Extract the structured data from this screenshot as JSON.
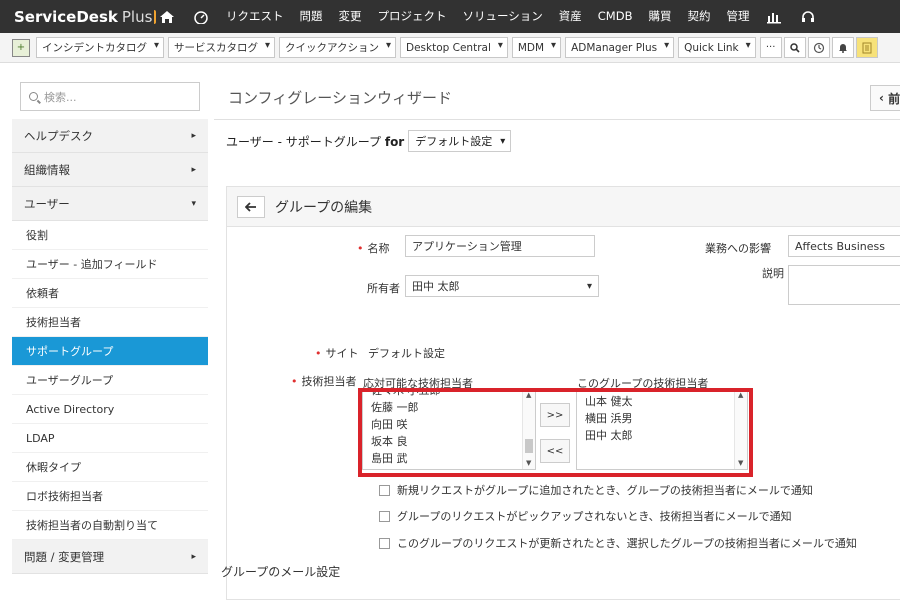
{
  "brand": {
    "name": "ServiceDesk",
    "plus": "Plus"
  },
  "topnav": {
    "items": [
      "リクエスト",
      "問題",
      "変更",
      "プロジェクト",
      "ソリューション",
      "資産",
      "CMDB",
      "購買",
      "契約",
      "管理"
    ]
  },
  "toolbar": {
    "dropdowns": [
      "インシデントカタログ",
      "サービスカタログ",
      "クイックアクション",
      "Desktop Central",
      "MDM",
      "ADManager Plus",
      "Quick Link"
    ],
    "more_label": "···"
  },
  "sidebar": {
    "search_placeholder": "検索...",
    "sections": [
      {
        "label": "ヘルプデスク"
      },
      {
        "label": "組織情報"
      },
      {
        "label": "ユーザー"
      }
    ],
    "items": [
      "役割",
      "ユーザー - 追加フィールド",
      "依頼者",
      "技術担当者",
      "サポートグループ",
      "ユーザーグループ",
      "Active Directory",
      "LDAP",
      "休暇タイプ",
      "ロボ技術担当者",
      "技術担当者の自動割り当て"
    ],
    "active_item": "サポートグループ",
    "bottom_section": {
      "label": "問題 / 変更管理"
    }
  },
  "main": {
    "wizard_title": "コンフィグレーションウィザード",
    "back_label": "前",
    "group_for_prefix": "ユーザー - サポートグループ",
    "group_for_bold": "for",
    "profile_value": "デフォルト設定",
    "edit_title": "グループの編集",
    "form": {
      "name_label": "名称",
      "name_value": "アプリケーション管理",
      "impact_label": "業務への影響",
      "impact_value": "Affects Business",
      "description_label": "説明",
      "owner_label": "所有者",
      "owner_value": "田中 太郎",
      "site_label": "サイト",
      "site_value": "デフォルト設定",
      "technicians_label": "技術担当者",
      "available_heading": "応対可能な技術担当者",
      "group_heading": "このグループの技術担当者",
      "available": [
        "佐々木 小五郎",
        "佐藤 一郎",
        "向田 咲",
        "坂本 良",
        "島田 武"
      ],
      "assigned": [
        "山本 健太",
        "横田 浜男",
        "田中 太郎"
      ],
      "add_label": ">>",
      "remove_label": "<<",
      "notify1": "新規リクエストがグループに追加されたとき、グループの技術担当者にメールで通知",
      "notify2": "グループのリクエストがピックアップされないとき、技術担当者にメールで通知",
      "notify3": "このグループのリクエストが更新されたとき、選択したグループの技術担当者にメールで通知",
      "mail_settings_label": "グループのメール設定"
    }
  },
  "colors": {
    "topbar": "#323232",
    "active": "#1a98d6",
    "highlight": "#d9232a"
  }
}
